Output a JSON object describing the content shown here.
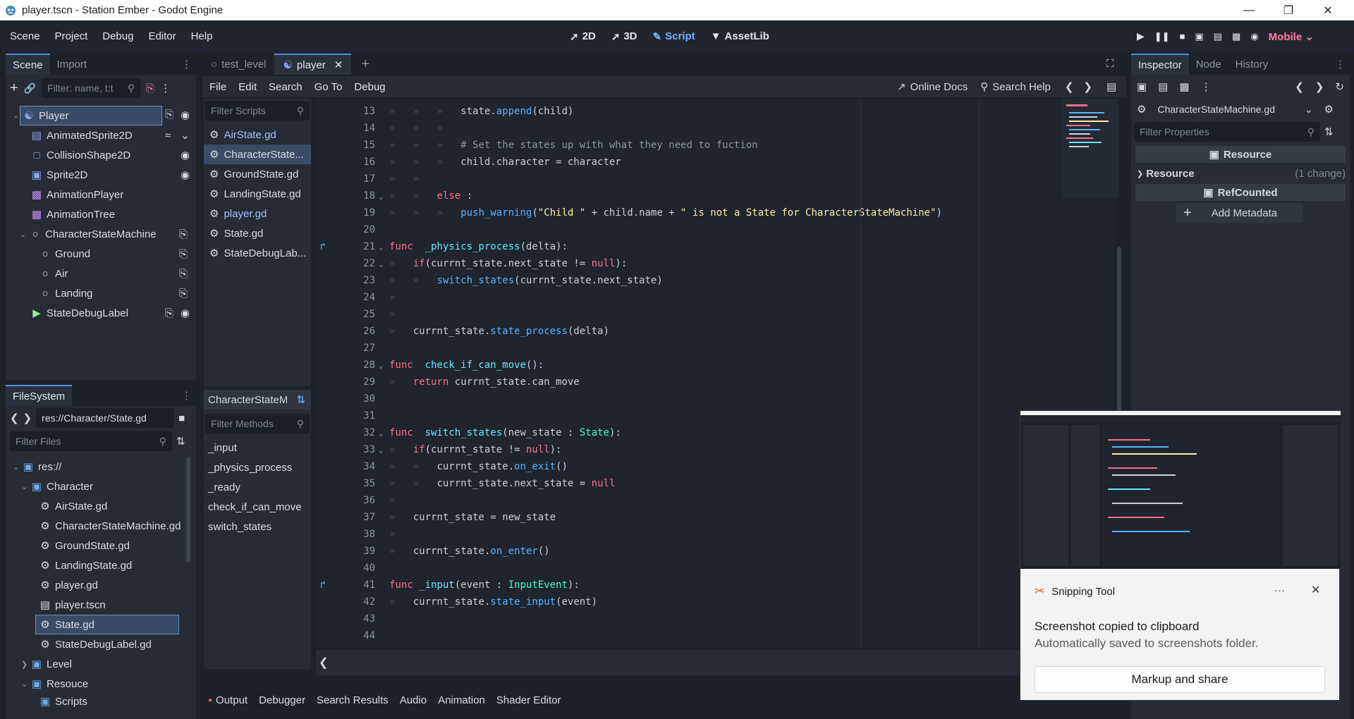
{
  "window": {
    "title": "player.tscn - Station Ember - Godot Engine"
  },
  "menu": {
    "items": [
      "Scene",
      "Project",
      "Debug",
      "Editor",
      "Help"
    ]
  },
  "workspaces": {
    "items": [
      "2D",
      "3D",
      "Script",
      "AssetLib"
    ],
    "active": "Script"
  },
  "renderer": "Mobile",
  "scene_dock": {
    "tabs": [
      "Scene",
      "Import"
    ],
    "filter_placeholder": "Filter: name, t:t",
    "nodes": [
      {
        "label": "Player",
        "icon": "character-icon"
      },
      {
        "label": "AnimatedSprite2D",
        "icon": "animated-sprite-icon"
      },
      {
        "label": "CollisionShape2D",
        "icon": "collision-shape-icon"
      },
      {
        "label": "Sprite2D",
        "icon": "sprite-icon"
      },
      {
        "label": "AnimationPlayer",
        "icon": "animation-player-icon"
      },
      {
        "label": "AnimationTree",
        "icon": "animation-tree-icon"
      },
      {
        "label": "CharacterStateMachine",
        "icon": "node-icon"
      },
      {
        "label": "Ground",
        "icon": "node-icon"
      },
      {
        "label": "Air",
        "icon": "node-icon"
      },
      {
        "label": "Landing",
        "icon": "node-icon"
      },
      {
        "label": "StateDebugLabel",
        "icon": "label-icon"
      }
    ]
  },
  "filesystem": {
    "tab": "FileSystem",
    "path": "res://Character/State.gd",
    "filter_placeholder": "Filter Files",
    "items": [
      {
        "label": "res://",
        "type": "folder"
      },
      {
        "label": "Character",
        "type": "folder"
      },
      {
        "label": "AirState.gd",
        "type": "script"
      },
      {
        "label": "CharacterStateMachine.gd",
        "type": "script"
      },
      {
        "label": "GroundState.gd",
        "type": "script"
      },
      {
        "label": "LandingState.gd",
        "type": "script"
      },
      {
        "label": "player.gd",
        "type": "script"
      },
      {
        "label": "player.tscn",
        "type": "scene"
      },
      {
        "label": "State.gd",
        "type": "script"
      },
      {
        "label": "StateDebugLabel.gd",
        "type": "script"
      },
      {
        "label": "Level",
        "type": "folder"
      },
      {
        "label": "Resouce",
        "type": "folder"
      },
      {
        "label": "Scripts",
        "type": "folder"
      }
    ]
  },
  "scene_tabs": [
    "test_level",
    "player"
  ],
  "script_menu": [
    "File",
    "Edit",
    "Search",
    "Go To",
    "Debug"
  ],
  "script_tools": {
    "online_docs": "Online Docs",
    "search_help": "Search Help"
  },
  "scripts_list": {
    "filter_placeholder": "Filter Scripts",
    "items": [
      "AirState.gd",
      "CharacterState...",
      "GroundState.gd",
      "LandingState.gd",
      "player.gd",
      "State.gd",
      "StateDebugLab..."
    ]
  },
  "methods": {
    "header": "CharacterStateM",
    "filter_placeholder": "Filter Methods",
    "items": [
      "_input",
      "_physics_process",
      "_ready",
      "check_if_can_move",
      "switch_states"
    ]
  },
  "code": {
    "lines": [
      {
        "n": "13",
        "indent": 3,
        "tokens": [
          [
            "tx",
            "state."
          ],
          [
            "fn",
            "append"
          ],
          [
            "tx",
            "(child)"
          ]
        ]
      },
      {
        "n": "14",
        "indent": 3,
        "tokens": []
      },
      {
        "n": "15",
        "indent": 3,
        "tokens": [
          [
            "cm",
            "# Set the states up with what they need to fuction"
          ]
        ]
      },
      {
        "n": "16",
        "indent": 3,
        "tokens": [
          [
            "tx",
            "child.character = character"
          ]
        ]
      },
      {
        "n": "17",
        "indent": 2,
        "tokens": []
      },
      {
        "n": "18",
        "indent": 2,
        "tokens": [
          [
            "kw",
            "else"
          ],
          [
            "tx",
            " :"
          ]
        ]
      },
      {
        "n": "19",
        "indent": 3,
        "tokens": [
          [
            "fn",
            "push_warning"
          ],
          [
            "tx",
            "("
          ],
          [
            "str",
            "\"Child \""
          ],
          [
            "tx",
            " + child.name + "
          ],
          [
            "str",
            "\" is not a State for CharacterStateMachine\""
          ],
          [
            "tx",
            ")"
          ]
        ]
      },
      {
        "n": "20",
        "indent": 0,
        "tokens": []
      },
      {
        "n": "21",
        "indent": 0,
        "tokens": [
          [
            "kw",
            "func"
          ],
          [
            "tx",
            "  "
          ],
          [
            "fnd",
            "_physics_process"
          ],
          [
            "tx",
            "(delta):"
          ]
        ]
      },
      {
        "n": "22",
        "indent": 1,
        "tokens": [
          [
            "kw",
            "if"
          ],
          [
            "tx",
            "(currnt_state.next_state != "
          ],
          [
            "kw",
            "null"
          ],
          [
            "tx",
            "):"
          ]
        ]
      },
      {
        "n": "23",
        "indent": 2,
        "tokens": [
          [
            "fn",
            "switch_states"
          ],
          [
            "tx",
            "(currnt_state.next_state)"
          ]
        ]
      },
      {
        "n": "24",
        "indent": 1,
        "tokens": []
      },
      {
        "n": "25",
        "indent": 1,
        "tokens": []
      },
      {
        "n": "26",
        "indent": 1,
        "tokens": [
          [
            "tx",
            "currnt_state."
          ],
          [
            "fn",
            "state_process"
          ],
          [
            "tx",
            "(delta)"
          ]
        ]
      },
      {
        "n": "27",
        "indent": 0,
        "tokens": []
      },
      {
        "n": "28",
        "indent": 0,
        "tokens": [
          [
            "kw",
            "func"
          ],
          [
            "tx",
            "  "
          ],
          [
            "fnd",
            "check_if_can_move"
          ],
          [
            "tx",
            "():"
          ]
        ]
      },
      {
        "n": "29",
        "indent": 1,
        "tokens": [
          [
            "kw",
            "return"
          ],
          [
            "tx",
            " currnt_state.can_move"
          ]
        ]
      },
      {
        "n": "30",
        "indent": 0,
        "tokens": []
      },
      {
        "n": "31",
        "indent": 0,
        "tokens": []
      },
      {
        "n": "32",
        "indent": 0,
        "tokens": [
          [
            "kw",
            "func"
          ],
          [
            "tx",
            "  "
          ],
          [
            "fnd",
            "switch_states"
          ],
          [
            "tx",
            "(new_state : "
          ],
          [
            "ty",
            "State"
          ],
          [
            "tx",
            "):"
          ]
        ]
      },
      {
        "n": "33",
        "indent": 1,
        "tokens": [
          [
            "kw",
            "if"
          ],
          [
            "tx",
            "(currnt_state != "
          ],
          [
            "kw",
            "null"
          ],
          [
            "tx",
            "):"
          ]
        ]
      },
      {
        "n": "34",
        "indent": 2,
        "tokens": [
          [
            "tx",
            "currnt_state."
          ],
          [
            "fn",
            "on_exit"
          ],
          [
            "tx",
            "()"
          ]
        ]
      },
      {
        "n": "35",
        "indent": 2,
        "tokens": [
          [
            "tx",
            "currnt_state.next_state = "
          ],
          [
            "kw",
            "null"
          ]
        ]
      },
      {
        "n": "36",
        "indent": 1,
        "tokens": []
      },
      {
        "n": "37",
        "indent": 1,
        "tokens": [
          [
            "tx",
            "currnt_state = new_state"
          ]
        ]
      },
      {
        "n": "38",
        "indent": 1,
        "tokens": []
      },
      {
        "n": "39",
        "indent": 1,
        "tokens": [
          [
            "tx",
            "currnt_state."
          ],
          [
            "fn",
            "on_enter"
          ],
          [
            "tx",
            "()"
          ]
        ]
      },
      {
        "n": "40",
        "indent": 0,
        "tokens": []
      },
      {
        "n": "41",
        "indent": 0,
        "tokens": [
          [
            "kw",
            "func"
          ],
          [
            "tx",
            " "
          ],
          [
            "fnd",
            "_input"
          ],
          [
            "tx",
            "(event : "
          ],
          [
            "ty",
            "InputEvent"
          ],
          [
            "tx",
            "):"
          ]
        ]
      },
      {
        "n": "42",
        "indent": 1,
        "tokens": [
          [
            "tx",
            "currnt_state."
          ],
          [
            "fn",
            "state_input"
          ],
          [
            "tx",
            "(event)"
          ]
        ]
      },
      {
        "n": "43",
        "indent": 0,
        "tokens": []
      },
      {
        "n": "44",
        "indent": 0,
        "tokens": []
      }
    ]
  },
  "bottom_tabs": [
    "Output",
    "Debugger",
    "Search Results",
    "Audio",
    "Animation",
    "Shader Editor"
  ],
  "inspector": {
    "tabs": [
      "Inspector",
      "Node",
      "History"
    ],
    "object": "CharacterStateMachine.gd",
    "filter_placeholder": "Filter Properties",
    "section_resource": "Resource",
    "resource_row": "Resource",
    "resource_change": "(1 change)",
    "section_refcounted": "RefCounted",
    "add_metadata": "Add Metadata"
  },
  "toast": {
    "app": "Snipping Tool",
    "more": "···",
    "title": "Screenshot copied to clipboard",
    "body": "Automatically saved to screenshots folder.",
    "button": "Markup and share"
  },
  "colors": {
    "accent": "#4d8fe0",
    "script_active": "#6fb3ff",
    "selection": "#3a4b66"
  }
}
